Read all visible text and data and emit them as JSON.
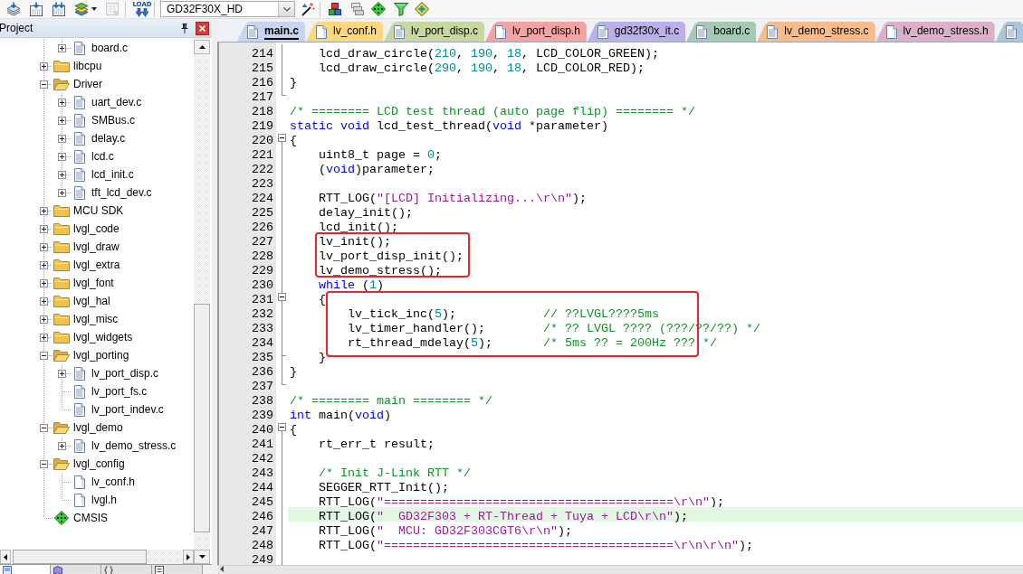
{
  "toolbar": {
    "buttons": [
      {
        "disabled": false,
        "menu": false
      },
      {
        "disabled": false,
        "menu": false
      },
      {
        "disabled": false,
        "menu": false
      },
      {
        "disabled": false,
        "menu": true
      },
      {
        "disabled": true,
        "menu": false
      }
    ],
    "load": {
      "label": "LOAD"
    },
    "target": {
      "value": "GD32F30X_HD"
    },
    "tools": [
      {
        "disabled": false
      },
      {
        "disabled": false
      },
      {
        "disabled": false
      },
      {
        "disabled": false
      },
      {
        "disabled": false
      },
      {
        "disabled": false
      }
    ]
  },
  "project": {
    "title": "Project",
    "tree": [
      {
        "kind": "continuation",
        "children": [
          {
            "kind": "c_file",
            "label": "board.c",
            "expandable": true,
            "expanded": false
          }
        ]
      },
      {
        "kind": "folder",
        "label": "libcpu",
        "expandable": true,
        "expanded": false
      },
      {
        "kind": "folder",
        "label": "Driver",
        "expandable": true,
        "expanded": true,
        "children": [
          {
            "kind": "c_file",
            "label": "uart_dev.c",
            "expandable": true,
            "expanded": false
          },
          {
            "kind": "c_file",
            "label": "SMBus.c",
            "expandable": true,
            "expanded": false
          },
          {
            "kind": "c_file",
            "label": "delay.c",
            "expandable": true,
            "expanded": false
          },
          {
            "kind": "c_file",
            "label": "lcd.c",
            "expandable": true,
            "expanded": false
          },
          {
            "kind": "c_file",
            "label": "lcd_init.c",
            "expandable": true,
            "expanded": false
          },
          {
            "kind": "c_file",
            "label": "tft_lcd_dev.c",
            "expandable": true,
            "expanded": false
          }
        ]
      },
      {
        "kind": "folder",
        "label": "MCU SDK",
        "expandable": true,
        "expanded": false
      },
      {
        "kind": "folder",
        "label": "lvgl_code",
        "expandable": true,
        "expanded": false
      },
      {
        "kind": "folder",
        "label": "lvgl_draw",
        "expandable": true,
        "expanded": false
      },
      {
        "kind": "folder",
        "label": "lvgl_extra",
        "expandable": true,
        "expanded": false
      },
      {
        "kind": "folder",
        "label": "lvgl_font",
        "expandable": true,
        "expanded": false
      },
      {
        "kind": "folder",
        "label": "lvgl_hal",
        "expandable": true,
        "expanded": false
      },
      {
        "kind": "folder",
        "label": "lvgl_misc",
        "expandable": true,
        "expanded": false
      },
      {
        "kind": "folder",
        "label": "lvgl_widgets",
        "expandable": true,
        "expanded": false
      },
      {
        "kind": "folder",
        "label": "lvgl_porting",
        "expandable": true,
        "expanded": true,
        "children": [
          {
            "kind": "c_file",
            "label": "lv_port_disp.c",
            "expandable": true,
            "expanded": false
          },
          {
            "kind": "c_file",
            "label": "lv_port_fs.c",
            "expandable": false
          },
          {
            "kind": "c_file",
            "label": "lv_port_indev.c",
            "expandable": false
          }
        ]
      },
      {
        "kind": "folder",
        "label": "lvgl_demo",
        "expandable": true,
        "expanded": true,
        "children": [
          {
            "kind": "c_file",
            "label": "lv_demo_stress.c",
            "expandable": true,
            "expanded": false
          }
        ]
      },
      {
        "kind": "folder",
        "label": "lvgl_config",
        "expandable": true,
        "expanded": true,
        "children": [
          {
            "kind": "h_file",
            "label": "lv_conf.h",
            "expandable": false
          },
          {
            "kind": "h_file",
            "label": "lvgl.h",
            "expandable": false
          }
        ]
      },
      {
        "kind": "component",
        "label": "CMSIS",
        "expandable": false
      }
    ],
    "tabs": [
      {
        "selected": true
      },
      {
        "selected": false
      },
      {
        "selected": false
      },
      {
        "selected": false
      }
    ]
  },
  "editor": {
    "tabs": [
      {
        "label": "main.c",
        "kind": "source",
        "selected": true,
        "color": "#c8d5f0"
      },
      {
        "label": "lv_conf.h",
        "kind": "header",
        "selected": false,
        "color": "#fbd77e"
      },
      {
        "label": "lv_port_disp.c",
        "kind": "source",
        "selected": false,
        "color": "#c9d8a2"
      },
      {
        "label": "lv_port_disp.h",
        "kind": "header",
        "selected": false,
        "color": "#f2a4a4"
      },
      {
        "label": "gd32f30x_it.c",
        "kind": "source",
        "selected": false,
        "color": "#bdb0e6"
      },
      {
        "label": "board.c",
        "kind": "source",
        "selected": false,
        "color": "#a6c9b7"
      },
      {
        "label": "lv_demo_stress.c",
        "kind": "source",
        "selected": false,
        "color": "#f8bb8c"
      },
      {
        "label": "lv_demo_stress.h",
        "kind": "header",
        "selected": false,
        "color": "#dbb1c8"
      },
      {
        "kind": "source",
        "selected": false,
        "color": "#abc5df"
      }
    ],
    "code": {
      "lines": [
        {
          "number": "214",
          "fold_box": false,
          "fold_line": true,
          "fold_end": false,
          "current": false,
          "boxed": false,
          "tokens": [
            {
              "kind": "plain",
              "text": "    lcd_draw_circle("
            },
            {
              "kind": "number",
              "text": "210"
            },
            {
              "kind": "plain",
              "text": ", "
            },
            {
              "kind": "number",
              "text": "190"
            },
            {
              "kind": "plain",
              "text": ", "
            },
            {
              "kind": "number",
              "text": "18"
            },
            {
              "kind": "plain",
              "text": ", LCD_COLOR_GREEN);"
            }
          ]
        },
        {
          "number": "215",
          "fold_box": false,
          "fold_line": true,
          "fold_end": false,
          "current": false,
          "boxed": false,
          "tokens": [
            {
              "kind": "plain",
              "text": "    lcd_draw_circle("
            },
            {
              "kind": "number",
              "text": "290"
            },
            {
              "kind": "plain",
              "text": ", "
            },
            {
              "kind": "number",
              "text": "190"
            },
            {
              "kind": "plain",
              "text": ", "
            },
            {
              "kind": "number",
              "text": "18"
            },
            {
              "kind": "plain",
              "text": ", LCD_COLOR_RED);"
            }
          ]
        },
        {
          "number": "216",
          "fold_box": false,
          "fold_line": true,
          "fold_end": false,
          "current": false,
          "boxed": false,
          "tokens": [
            {
              "kind": "plain",
              "text": "}"
            }
          ]
        },
        {
          "number": "217",
          "fold_box": false,
          "fold_line": false,
          "fold_end": true,
          "current": false,
          "boxed": false
        },
        {
          "number": "218",
          "fold_box": false,
          "fold_line": false,
          "fold_end": false,
          "current": false,
          "boxed": false,
          "tokens": [
            {
              "kind": "comment",
              "text": "/* ======== LCD test thread (auto page flip) ======== */"
            }
          ]
        },
        {
          "number": "219",
          "fold_box": false,
          "fold_line": false,
          "fold_end": false,
          "current": false,
          "boxed": false,
          "tokens": [
            {
              "kind": "keyword",
              "text": "static void"
            },
            {
              "kind": "plain",
              "text": " lcd_test_thread("
            },
            {
              "kind": "keyword",
              "text": "void"
            },
            {
              "kind": "plain",
              "text": " *parameter)"
            }
          ]
        },
        {
          "number": "220",
          "fold_box": true,
          "fold_line": false,
          "fold_end": false,
          "current": false,
          "boxed": false,
          "tokens": [
            {
              "kind": "plain",
              "text": "{"
            }
          ]
        },
        {
          "number": "221",
          "fold_box": false,
          "fold_line": true,
          "fold_end": false,
          "current": false,
          "boxed": false,
          "tokens": [
            {
              "kind": "plain",
              "text": "    uint8_t page = "
            },
            {
              "kind": "number",
              "text": "0"
            },
            {
              "kind": "plain",
              "text": ";"
            }
          ]
        },
        {
          "number": "222",
          "fold_box": false,
          "fold_line": true,
          "fold_end": false,
          "current": false,
          "boxed": false,
          "tokens": [
            {
              "kind": "plain",
              "text": "    ("
            },
            {
              "kind": "keyword",
              "text": "void"
            },
            {
              "kind": "plain",
              "text": ")parameter;"
            }
          ]
        },
        {
          "number": "223",
          "fold_box": false,
          "fold_line": true,
          "fold_end": false,
          "current": false,
          "boxed": false
        },
        {
          "number": "224",
          "fold_box": false,
          "fold_line": true,
          "fold_end": false,
          "current": false,
          "boxed": false,
          "tokens": [
            {
              "kind": "plain",
              "text": "    RTT_LOG("
            },
            {
              "kind": "string",
              "text": "\"[LCD] Initializing...\\r\\n\""
            },
            {
              "kind": "plain",
              "text": ");"
            }
          ]
        },
        {
          "number": "225",
          "fold_box": false,
          "fold_line": true,
          "fold_end": false,
          "current": false,
          "boxed": false,
          "tokens": [
            {
              "kind": "plain",
              "text": "    delay_init();"
            }
          ]
        },
        {
          "number": "226",
          "fold_box": false,
          "fold_line": true,
          "fold_end": false,
          "current": false,
          "boxed": false,
          "tokens": [
            {
              "kind": "plain",
              "text": "    lcd_init();"
            }
          ]
        },
        {
          "number": "227",
          "fold_box": false,
          "fold_line": true,
          "fold_end": false,
          "current": false,
          "boxed": true,
          "tokens": [
            {
              "kind": "plain",
              "text": "    lv_init();"
            }
          ]
        },
        {
          "number": "228",
          "fold_box": false,
          "fold_line": true,
          "fold_end": false,
          "current": false,
          "boxed": true,
          "tokens": [
            {
              "kind": "plain",
              "text": "    lv_port_disp_init();"
            }
          ]
        },
        {
          "number": "229",
          "fold_box": false,
          "fold_line": true,
          "fold_end": false,
          "current": false,
          "boxed": true,
          "tokens": [
            {
              "kind": "plain",
              "text": "    lv_demo_stress();"
            }
          ]
        },
        {
          "number": "230",
          "fold_box": false,
          "fold_line": true,
          "fold_end": false,
          "current": false,
          "boxed": false,
          "tokens": [
            {
              "kind": "keyword",
              "text": "    while"
            },
            {
              "kind": "plain",
              "text": " ("
            },
            {
              "kind": "number",
              "text": "1"
            },
            {
              "kind": "plain",
              "text": ")"
            }
          ]
        },
        {
          "number": "231",
          "fold_box": true,
          "fold_line": true,
          "fold_end": false,
          "current": false,
          "boxed": false,
          "tokens": [
            {
              "kind": "plain",
              "text": "    {"
            }
          ]
        },
        {
          "number": "232",
          "fold_box": false,
          "fold_line": true,
          "fold_end": false,
          "current": false,
          "boxed": true,
          "tokens": [
            {
              "kind": "plain",
              "text": "        lv_tick_inc("
            },
            {
              "kind": "number",
              "text": "5"
            },
            {
              "kind": "plain",
              "text": ");            "
            },
            {
              "kind": "comment",
              "text": "// ??LVGL????5ms"
            }
          ]
        },
        {
          "number": "233",
          "fold_box": false,
          "fold_line": true,
          "fold_end": false,
          "current": false,
          "boxed": true,
          "tokens": [
            {
              "kind": "plain",
              "text": "        lv_timer_handler();        "
            },
            {
              "kind": "comment",
              "text": "/* ?? LVGL ???? (???/??/??) */"
            }
          ]
        },
        {
          "number": "234",
          "fold_box": false,
          "fold_line": true,
          "fold_end": false,
          "current": false,
          "boxed": true,
          "tokens": [
            {
              "kind": "plain",
              "text": "        rt_thread_mdelay("
            },
            {
              "kind": "number",
              "text": "5"
            },
            {
              "kind": "plain",
              "text": ");       "
            },
            {
              "kind": "comment",
              "text": "/* 5ms ?? = 200Hz ??? */"
            }
          ]
        },
        {
          "number": "235",
          "fold_box": false,
          "fold_line": true,
          "fold_end": true,
          "current": false,
          "boxed": false,
          "tokens": [
            {
              "kind": "plain",
              "text": "    }"
            }
          ]
        },
        {
          "number": "236",
          "fold_box": false,
          "fold_line": true,
          "fold_end": false,
          "current": false,
          "boxed": false,
          "tokens": [
            {
              "kind": "plain",
              "text": "}"
            }
          ]
        },
        {
          "number": "237",
          "fold_box": false,
          "fold_line": false,
          "fold_end": true,
          "current": false,
          "boxed": false
        },
        {
          "number": "238",
          "fold_box": false,
          "fold_line": false,
          "fold_end": false,
          "current": false,
          "boxed": false,
          "tokens": [
            {
              "kind": "comment",
              "text": "/* ======== main ======== */"
            }
          ]
        },
        {
          "number": "239",
          "fold_box": false,
          "fold_line": false,
          "fold_end": false,
          "current": false,
          "boxed": false,
          "tokens": [
            {
              "kind": "keyword",
              "text": "int"
            },
            {
              "kind": "plain",
              "text": " main("
            },
            {
              "kind": "keyword",
              "text": "void"
            },
            {
              "kind": "plain",
              "text": ")"
            }
          ]
        },
        {
          "number": "240",
          "fold_box": true,
          "fold_line": false,
          "fold_end": false,
          "current": false,
          "boxed": false,
          "tokens": [
            {
              "kind": "plain",
              "text": "{"
            }
          ]
        },
        {
          "number": "241",
          "fold_box": false,
          "fold_line": true,
          "fold_end": false,
          "current": false,
          "boxed": false,
          "tokens": [
            {
              "kind": "plain",
              "text": "    rt_err_t result;"
            }
          ]
        },
        {
          "number": "242",
          "fold_box": false,
          "fold_line": true,
          "fold_end": false,
          "current": false,
          "boxed": false
        },
        {
          "number": "243",
          "fold_box": false,
          "fold_line": true,
          "fold_end": false,
          "current": false,
          "boxed": false,
          "tokens": [
            {
              "kind": "comment",
              "text": "    /* Init J-Link RTT */"
            }
          ]
        },
        {
          "number": "244",
          "fold_box": false,
          "fold_line": true,
          "fold_end": false,
          "current": false,
          "boxed": false,
          "tokens": [
            {
              "kind": "plain",
              "text": "    SEGGER_RTT_Init();"
            }
          ]
        },
        {
          "number": "245",
          "fold_box": false,
          "fold_line": true,
          "fold_end": false,
          "current": false,
          "boxed": false,
          "tokens": [
            {
              "kind": "plain",
              "text": "    RTT_LOG("
            },
            {
              "kind": "string",
              "text": "\"========================================\\r\\n\""
            },
            {
              "kind": "plain",
              "text": ");"
            }
          ]
        },
        {
          "number": "246",
          "fold_box": false,
          "fold_line": true,
          "fold_end": false,
          "current": true,
          "boxed": false,
          "tokens": [
            {
              "kind": "plain",
              "text": "    RTT_LOG("
            },
            {
              "kind": "string",
              "text": "\"  GD32F303 + RT-Thread + Tuya + LCD\\r\\n\""
            },
            {
              "kind": "plain",
              "text": ");"
            }
          ]
        },
        {
          "number": "247",
          "fold_box": false,
          "fold_line": true,
          "fold_end": false,
          "current": false,
          "boxed": false,
          "tokens": [
            {
              "kind": "plain",
              "text": "    RTT_LOG("
            },
            {
              "kind": "string",
              "text": "\"  MCU: GD32F303CGT6\\r\\n\""
            },
            {
              "kind": "plain",
              "text": ");"
            }
          ]
        },
        {
          "number": "248",
          "fold_box": false,
          "fold_line": true,
          "fold_end": false,
          "current": false,
          "boxed": false,
          "tokens": [
            {
              "kind": "plain",
              "text": "    RTT_LOG("
            },
            {
              "kind": "string",
              "text": "\"========================================\\r\\n\\r\\n\""
            },
            {
              "kind": "plain",
              "text": ");"
            }
          ]
        },
        {
          "number": "249",
          "fold_box": false,
          "fold_line": true,
          "fold_end": false,
          "current": false,
          "boxed": false
        }
      ]
    }
  }
}
